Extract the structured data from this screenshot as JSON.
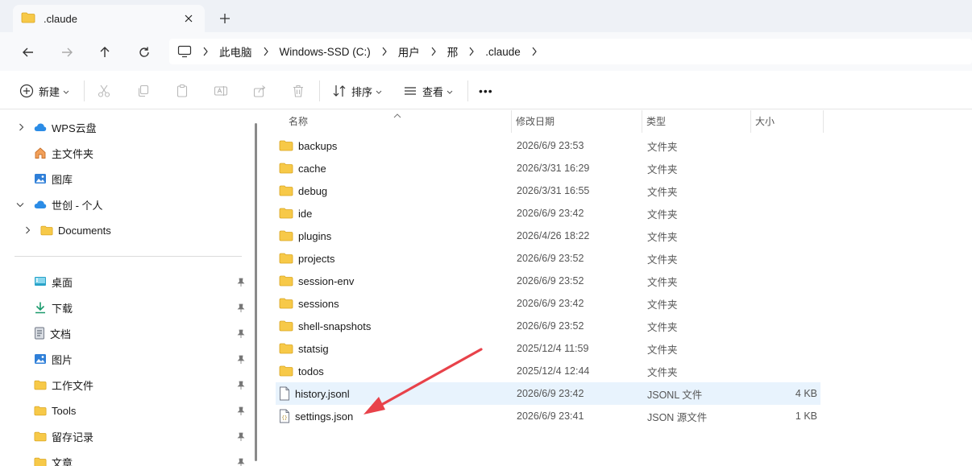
{
  "window": {
    "tab_title": ".claude",
    "new_tab": "+"
  },
  "address": {
    "crumbs": [
      "此电脑",
      "Windows-SSD (C:)",
      "用户",
      "邢",
      ".claude"
    ]
  },
  "toolbar": {
    "new_label": "新建",
    "sort_label": "排序",
    "view_label": "查看",
    "more_label": "•••"
  },
  "sidebar": {
    "items": [
      {
        "label": "WPS云盘"
      },
      {
        "label": "主文件夹"
      },
      {
        "label": "图库"
      },
      {
        "label": "世创 - 个人"
      },
      {
        "label": "Documents"
      },
      {
        "label": "桌面"
      },
      {
        "label": "下载"
      },
      {
        "label": "文档"
      },
      {
        "label": "图片"
      },
      {
        "label": "工作文件"
      },
      {
        "label": "Tools"
      },
      {
        "label": "留存记录"
      },
      {
        "label": "文章"
      }
    ]
  },
  "columns": {
    "name": "名称",
    "date": "修改日期",
    "type": "类型",
    "size": "大小"
  },
  "files": [
    {
      "name": "backups",
      "date": "2026/6/9 23:53",
      "type": "文件夹",
      "size": "",
      "kind": "folder"
    },
    {
      "name": "cache",
      "date": "2026/3/31 16:29",
      "type": "文件夹",
      "size": "",
      "kind": "folder"
    },
    {
      "name": "debug",
      "date": "2026/3/31 16:55",
      "type": "文件夹",
      "size": "",
      "kind": "folder"
    },
    {
      "name": "ide",
      "date": "2026/6/9 23:42",
      "type": "文件夹",
      "size": "",
      "kind": "folder"
    },
    {
      "name": "plugins",
      "date": "2026/4/26 18:22",
      "type": "文件夹",
      "size": "",
      "kind": "folder"
    },
    {
      "name": "projects",
      "date": "2026/6/9 23:52",
      "type": "文件夹",
      "size": "",
      "kind": "folder"
    },
    {
      "name": "session-env",
      "date": "2026/6/9 23:52",
      "type": "文件夹",
      "size": "",
      "kind": "folder"
    },
    {
      "name": "sessions",
      "date": "2026/6/9 23:42",
      "type": "文件夹",
      "size": "",
      "kind": "folder"
    },
    {
      "name": "shell-snapshots",
      "date": "2026/6/9 23:52",
      "type": "文件夹",
      "size": "",
      "kind": "folder"
    },
    {
      "name": "statsig",
      "date": "2025/12/4 11:59",
      "type": "文件夹",
      "size": "",
      "kind": "folder"
    },
    {
      "name": "todos",
      "date": "2025/12/4 12:44",
      "type": "文件夹",
      "size": "",
      "kind": "folder"
    },
    {
      "name": "history.jsonl",
      "date": "2026/6/9 23:42",
      "type": "JSONL 文件",
      "size": "4 KB",
      "kind": "file"
    },
    {
      "name": "settings.json",
      "date": "2026/6/9 23:41",
      "type": "JSON 源文件",
      "size": "1 KB",
      "kind": "json"
    }
  ],
  "colors": {
    "folder": "#f7c948",
    "selection": "#e8f3fd",
    "annotation_arrow": "#e8424a"
  }
}
